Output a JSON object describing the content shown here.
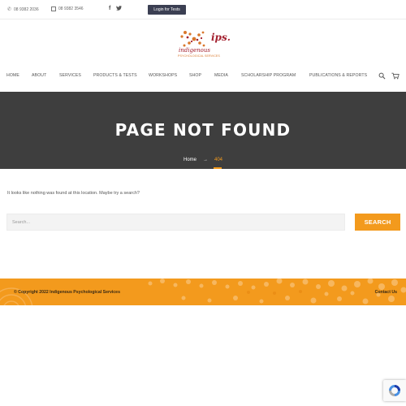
{
  "topbar": {
    "phone": "08 9382 2036",
    "fax": "08 9382 3546",
    "social": [
      "facebook-icon",
      "twitter-icon"
    ],
    "login_label": "Login for Tests"
  },
  "logo": {
    "mark": "ips.",
    "name": "indigenous",
    "subtitle": "PSYCHOLOGICAL SERVICES"
  },
  "nav": {
    "items": [
      "HOME",
      "ABOUT",
      "SERVICES",
      "PRODUCTS & TESTS",
      "WORKSHOPS",
      "SHOP",
      "MEDIA",
      "SCHOLARSHIP PROGRAM",
      "PUBLICATIONS & REPORTS"
    ],
    "icons": [
      "search-icon",
      "cart-icon"
    ]
  },
  "hero": {
    "title": "PAGE NOT FOUND",
    "breadcrumb_home": "Home",
    "breadcrumb_current": "404"
  },
  "content": {
    "message": "It looks like nothing was found at this location. Maybe try a search?",
    "search_placeholder": "Search...",
    "search_button": "SEARCH"
  },
  "footer": {
    "copyright": "© Copyright 2022 Indigenous Psychological Services",
    "contact_link": "Contact Us"
  },
  "colors": {
    "accent": "#f39a1d",
    "hero_bg": "#3e3e3e",
    "login_bg": "#3b3f52",
    "brand": "#a3202f"
  }
}
